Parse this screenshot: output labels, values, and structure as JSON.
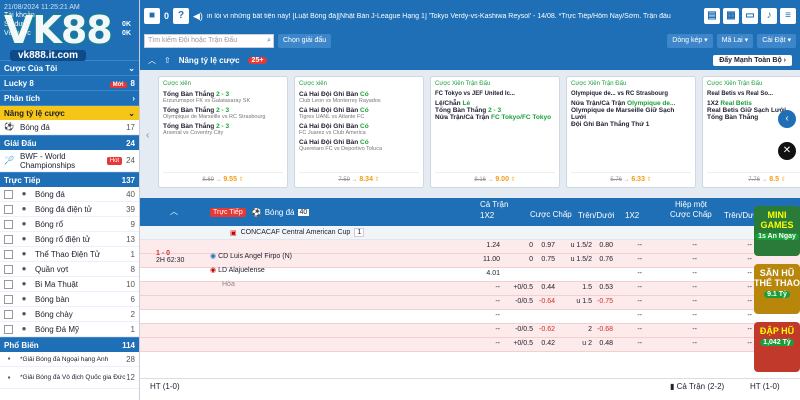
{
  "sidebar": {
    "header_time": "21/08/2024 11:25:21 AM",
    "balance_rows": [
      {
        "label": "Tài khoản",
        "value": ""
      },
      {
        "label": "Số dư",
        "value": "0K"
      },
      {
        "label": "Vé cược",
        "value": "0K"
      }
    ],
    "logo": "VK88",
    "logo_url": "vk888.it.com",
    "sections": [
      {
        "title": "Cược Của Tôi",
        "count": ""
      },
      {
        "title": "Lucky 8",
        "count": "8",
        "badge": "Mới"
      },
      {
        "title": "Phân tích",
        "count": ""
      },
      {
        "title": "Nâng tỷ lệ cược",
        "count": ""
      }
    ],
    "boost_items": [
      {
        "label": "Bóng đá",
        "count": "17"
      }
    ],
    "early_title": "Giải Đấu",
    "early_count": "24",
    "early_items": [
      {
        "label": "BWF - World Championships",
        "count": "24",
        "badge": "Hot"
      }
    ],
    "live_title": "Trực Tiếp",
    "live_count": "137",
    "live_items": [
      {
        "label": "Bóng đá",
        "count": "40"
      },
      {
        "label": "Bóng đá điện tử",
        "count": "39"
      },
      {
        "label": "Bóng rổ",
        "count": "9"
      },
      {
        "label": "Bóng rổ điện tử",
        "count": "13"
      },
      {
        "label": "Thể Thao Điện Tử",
        "count": "1"
      },
      {
        "label": "Quần vợt",
        "count": "8"
      },
      {
        "label": "Bi Ma Thuật",
        "count": "10"
      },
      {
        "label": "Bóng bàn",
        "count": "6"
      },
      {
        "label": "Bóng chày",
        "count": "2"
      },
      {
        "label": "Bóng Đá Mỹ",
        "count": "1"
      }
    ],
    "popular_title": "Phổ Biến",
    "popular_count": "114",
    "popular_items": [
      {
        "label": "*Giải Bóng đá Ngoại hạng Anh",
        "count": "28"
      },
      {
        "label": "*Giải Bóng đá Vô địch Quốc gia Đức",
        "count": "12"
      }
    ]
  },
  "topbar": {
    "ticker": "in lối vi những bất tiện này!   [Luật Bóng đá][Nhật Bản J-League Hạng 1] 'Tokyo Verdy-vs-Kashiwa Reysol' - 14/08. *Trực Tiếp/Hôm Nay/Sớm. Trận đấu"
  },
  "toolbar": {
    "search_placeholder": "Tìm kiếm Đội hoặc Trận Đấu",
    "select_league": "Chọn giải đấu",
    "sort": "Dòng kép",
    "odds_type": "Mã Lai",
    "settings": "Cài Đặt"
  },
  "promo": {
    "title": "Nâng tỷ lệ cược",
    "count": "25+",
    "boost_all": "Đẩy Mạnh Toàn Bộ",
    "cards": [
      {
        "type": "Cược xiên",
        "teams": "",
        "lines": [
          {
            "m": "Tổng Bàn Thắng",
            "s": "2 - 3",
            "t": "Erzurumspor FK vs Galatasaray SK"
          },
          {
            "m": "Tổng Bàn Thắng",
            "s": "2 - 3",
            "t": "Olympique de Marseille vs RC Strasbourg"
          },
          {
            "m": "Tổng Bàn Thắng",
            "s": "2 - 3",
            "t": "Arsenal vs Coventry City"
          }
        ],
        "old": "8.69",
        "new": "9.55"
      },
      {
        "type": "Cược xiên",
        "teams": "",
        "lines": [
          {
            "m": "Cả Hai Đội Ghi Bàn",
            "s": "Có",
            "t": "Club Leon vs Monterrey Rayados"
          },
          {
            "m": "Cả Hai Đội Ghi Bàn",
            "s": "Có",
            "t": "Tigres UANL vs Atlante FC"
          },
          {
            "m": "Cả Hai Đội Ghi Bàn",
            "s": "Có",
            "t": "FC Juarez vs Club America"
          },
          {
            "m": "Cả Hai Đội Ghi Bàn",
            "s": "Có",
            "t": "Queretaro FC vs Deportivo Toluca"
          }
        ],
        "old": "7.59",
        "new": "8.34"
      },
      {
        "type": "Cược Xiên Trận Đấu",
        "teams": "FC Tokyo vs JEF United Ic...",
        "lines": [
          {
            "m": "Lệ/Chẵn",
            "s": "Lẻ",
            "t": ""
          },
          {
            "m": "Tổng Bàn Thắng",
            "s": "2 - 3",
            "t": ""
          },
          {
            "m": "Nửa Trận/Cả Trận",
            "s": "FC Tokyo/FC Tokyo",
            "t": ""
          }
        ],
        "old": "8.16",
        "new": "9.00"
      },
      {
        "type": "Cược Xiên Trận Đấu",
        "teams": "Olympique de... vs RC Strasbourg",
        "lines": [
          {
            "m": "Nửa Trận/Cả Trận",
            "s": "Olympique de...",
            "t": ""
          },
          {
            "m": "Olympique de Marseille Giữ Sạch Lưới",
            "s": "",
            "t": ""
          },
          {
            "m": "Đội Ghi Bàn Thắng Thứ 1",
            "s": "",
            "t": ""
          }
        ],
        "old": "5.76",
        "new": "6.33"
      },
      {
        "type": "Cược Xiên Trận Đấu",
        "teams": "Real Betis vs Real So...",
        "lines": [
          {
            "m": "1X2",
            "s": "Real Betis",
            "t": ""
          },
          {
            "m": "Real Betis Giữ Sạch Lưới",
            "s": "",
            "t": ""
          },
          {
            "m": "Tổng Bàn Thắng",
            "s": "",
            "t": ""
          }
        ],
        "old": "7.76",
        "new": "8.5"
      }
    ]
  },
  "table": {
    "live_badge": "Trực Tiếp",
    "sport": "Bóng đá",
    "sport_count": "40",
    "ft_title": "Cả Trận",
    "ht_title": "Hiệp một",
    "cols": [
      "1X2",
      "Cược Chấp",
      "Trên/Dưới",
      "1X2",
      "Cược Chấp",
      "Trên/Dưới"
    ],
    "league": "CONCACAF Central American Cup",
    "league_count": "1",
    "match": {
      "score": "1 - 0",
      "time": "2H 62:30",
      "home": "CD Luis Angel Firpo",
      "home_tag": "(N)",
      "away": "LD Alajuelense",
      "draw": "Hòa"
    },
    "rows": [
      {
        "x": "1.24",
        "h1": "0",
        "h2": "0.97",
        "o1": "u 1.5/2",
        "o2": "0.80"
      },
      {
        "x": "11.00",
        "h1": "0",
        "h2": "0.75",
        "o1": "u 1.5/2",
        "o2": "0.76"
      },
      {
        "x": "4.01",
        "h1": "",
        "h2": "",
        "o1": "",
        "o2": ""
      },
      {
        "x": "--",
        "h1": "+0/0.5",
        "h2": "0.44",
        "o1": "1.5",
        "o2": "0.53"
      },
      {
        "x": "--",
        "h1": "-0/0.5",
        "h2": "-0.64",
        "o1": "u 1.5",
        "o2": "-0.75"
      },
      {
        "x": "--",
        "h1": "",
        "h2": "",
        "o1": "",
        "o2": ""
      },
      {
        "x": "--",
        "h1": "-0/0.5",
        "h2": "-0.62",
        "o1": "2",
        "o2": "-0.68"
      },
      {
        "x": "--",
        "h1": "+0/0.5",
        "h2": "0.42",
        "o1": "u 2",
        "o2": "0.48"
      }
    ],
    "footer_left": "HT (1-0)",
    "footer_mid": "Cả Trận (2-2)",
    "footer_right": "HT (1-0)"
  },
  "side_promos": [
    {
      "title": "MINI GAMES",
      "amount": "1s An Ngay"
    },
    {
      "title": "SĂN HŨ THỂ THAO",
      "amount": "9.1 Tỷ"
    },
    {
      "title": "ĐẬP HŨ",
      "amount": "1,042 Tỷ"
    }
  ]
}
